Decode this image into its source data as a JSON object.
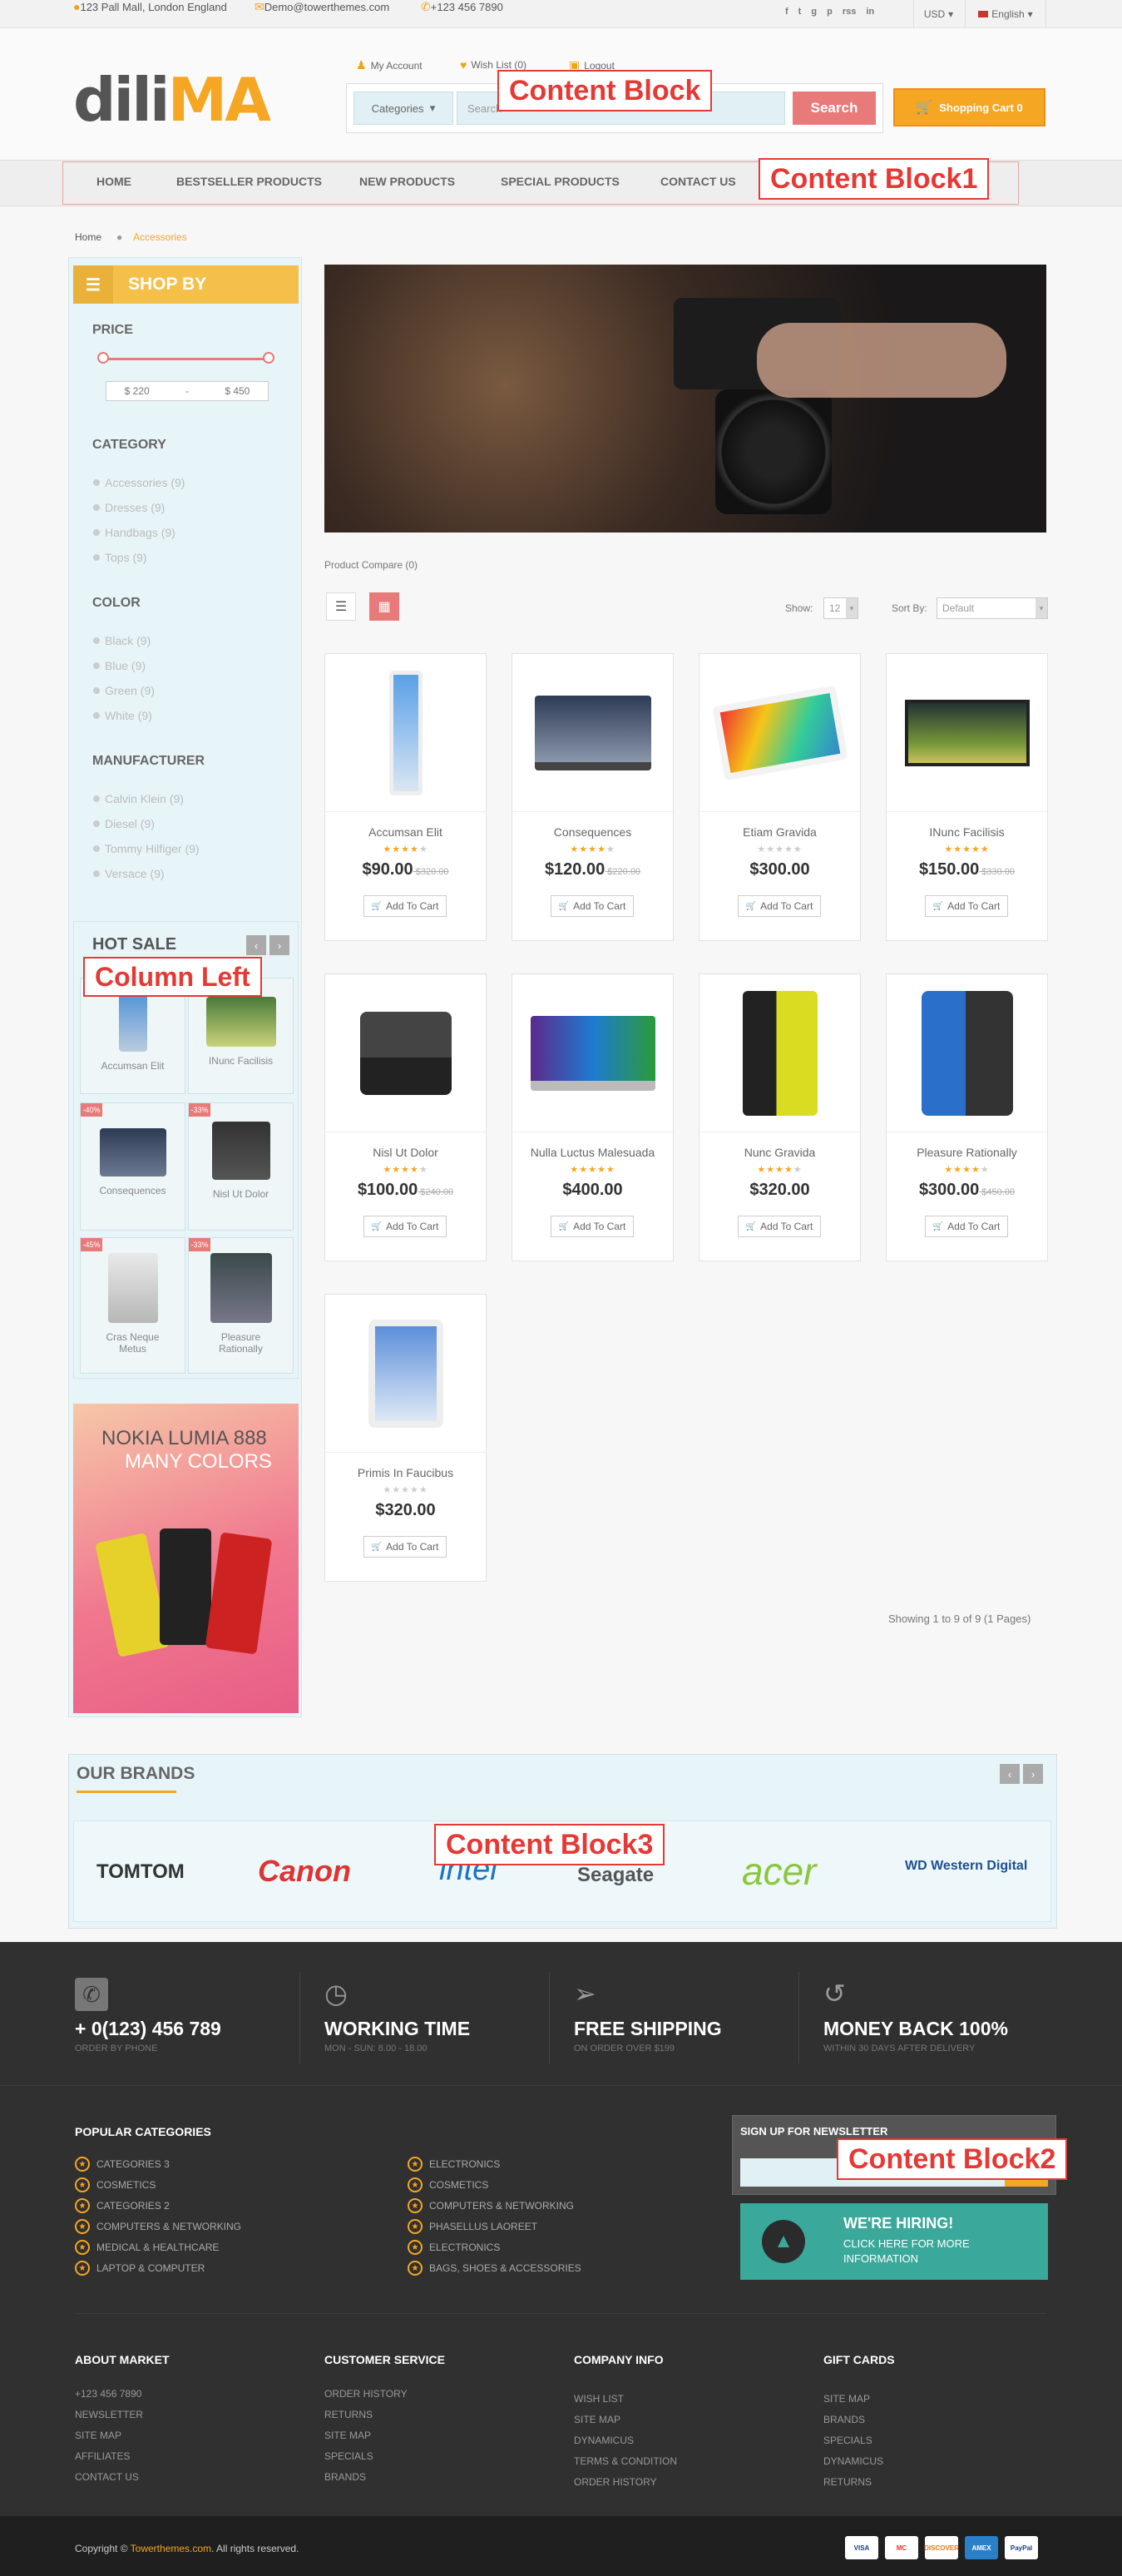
{
  "topbar": {
    "address": "123 Pall Mall, London England",
    "email": "Demo@towerthemes.com",
    "phone": "+123 456 7890",
    "social": [
      "f",
      "t",
      "g",
      "p",
      "rss",
      "in"
    ],
    "currency": "USD",
    "language": "English"
  },
  "header": {
    "logo_a": "dili",
    "logo_b": "MA",
    "my_account": "My Account",
    "wishlist": "Wish List (0)",
    "logout": "Logout",
    "category_select": "Categories",
    "search_placeholder": "Search",
    "search_button": "Search",
    "cart": "Shopping Cart 0"
  },
  "annotations": {
    "content_block": "Content Block",
    "content_block1": "Content Block1",
    "column_left": "Column Left",
    "content_block3": "Content Block3",
    "content_block2": "Content Block2"
  },
  "nav": [
    "HOME",
    "BESTSELLER PRODUCTS",
    "NEW PRODUCTS",
    "SPECIAL PRODUCTS",
    "CONTACT US"
  ],
  "breadcrumb": {
    "home": "Home",
    "current": "Accessories"
  },
  "sidebar": {
    "shop_by": "SHOP BY",
    "price_title": "PRICE",
    "price_min": "$ 220",
    "price_dash": "-",
    "price_max": "$ 450",
    "category_title": "CATEGORY",
    "categories": [
      "Accessories (9)",
      "Dresses (9)",
      "Handbags (9)",
      "Tops (9)"
    ],
    "color_title": "COLOR",
    "colors": [
      "Black (9)",
      "Blue (9)",
      "Green (9)",
      "White (9)"
    ],
    "manufacturer_title": "MANUFACTURER",
    "manufacturers": [
      "Calvin Klein (9)",
      "Diesel (9)",
      "Tommy Hilfiger (9)",
      "Versace (9)"
    ]
  },
  "hot_sale": {
    "title": "HOT SALE",
    "items": [
      {
        "name": "Accumsan Elit",
        "badge": ""
      },
      {
        "name": "INunc Facilisis",
        "badge": ""
      },
      {
        "name": "Consequences",
        "badge": "-40%"
      },
      {
        "name": "Nisl Ut Dolor",
        "badge": "-33%"
      },
      {
        "name": "Cras Neque Metus",
        "badge": "-45%"
      },
      {
        "name": "Pleasure Rationally",
        "badge": "-33%"
      }
    ]
  },
  "nokia_banner": {
    "line1": "NOKIA LUMIA 888",
    "line2": "MANY COLORS"
  },
  "toolbar": {
    "compare": "Product Compare (0)",
    "show_label": "Show:",
    "show_value": "12",
    "sort_label": "Sort By:",
    "sort_value": "Default"
  },
  "products": [
    {
      "name": "Accumsan Elit",
      "price": "$90.00",
      "old": "$320.00",
      "rating": 4,
      "img": "phone-white"
    },
    {
      "name": "Consequences",
      "price": "$120.00",
      "old": "$220.00",
      "rating": 4,
      "img": "laptop"
    },
    {
      "name": "Etiam Gravida",
      "price": "$300.00",
      "old": "",
      "rating": 0,
      "img": "tablet"
    },
    {
      "name": "INunc Facilisis",
      "price": "$150.00",
      "old": "$330.00",
      "rating": 5,
      "img": "monitor"
    },
    {
      "name": "Nisl Ut Dolor",
      "price": "$100.00",
      "old": "$240.00",
      "rating": 4,
      "img": "gamepad"
    },
    {
      "name": "Nulla Luctus Malesuada",
      "price": "$400.00",
      "old": "",
      "rating": 5,
      "img": "laptop-win"
    },
    {
      "name": "Nunc Gravida",
      "price": "$320.00",
      "old": "",
      "rating": 4,
      "img": "phone-yellow"
    },
    {
      "name": "Pleasure Rationally",
      "price": "$300.00",
      "old": "$450.00",
      "rating": 4,
      "img": "phone-black"
    },
    {
      "name": "Primis In Faucibus",
      "price": "$320.00",
      "old": "",
      "rating": 0,
      "img": "ipad"
    }
  ],
  "add_to_cart": "Add To Cart",
  "pagination": "Showing 1 to 9 of 9 (1 Pages)",
  "brands": {
    "title": "OUR BRANDS",
    "items": [
      "TOMTOM",
      "Canon",
      "intel",
      "Seagate",
      "acer",
      "WD Western Digital"
    ]
  },
  "features": [
    {
      "title": "+ 0(123) 456 789",
      "sub": "ORDER BY PHONE",
      "icon": "phone-icon"
    },
    {
      "title": "WORKING TIME",
      "sub": "MON - SUN: 8.00 - 18.00",
      "icon": "clock-icon"
    },
    {
      "title": "FREE SHIPPING",
      "sub": "ON ORDER OVER $199",
      "icon": "plane-icon"
    },
    {
      "title": "MONEY BACK 100%",
      "sub": "WITHIN 30 DAYS AFTER DELIVERY",
      "icon": "refresh-icon"
    }
  ],
  "popular": {
    "title": "POPULAR CATEGORIES",
    "col1": [
      "CATEGORIES 3",
      "COSMETICS",
      "CATEGORIES 2",
      "COMPUTERS & NETWORKING",
      "MEDICAL & HEALTHCARE",
      "LAPTOP & COMPUTER"
    ],
    "col2": [
      "ELECTRONICS",
      "COSMETICS",
      "COMPUTERS & NETWORKING",
      "PHASELLUS LAOREET",
      "ELECTRONICS",
      "BAGS, SHOES & ACCESSORIES"
    ]
  },
  "newsletter": {
    "title": "SIGN UP FOR NEWSLETTER"
  },
  "hiring": {
    "title": "WE'RE HIRING!",
    "sub": "CLICK HERE FOR MORE INFORMATION"
  },
  "footer_cols": [
    {
      "title": "ABOUT MARKET",
      "links": [
        "+123 456 7890",
        "NEWSLETTER",
        "SITE MAP",
        "AFFILIATES",
        "CONTACT US"
      ]
    },
    {
      "title": "CUSTOMER SERVICE",
      "links": [
        "ORDER HISTORY",
        "RETURNS",
        "SITE MAP",
        "SPECIALS",
        "BRANDS"
      ]
    },
    {
      "title": "COMPANY INFO",
      "links": [
        "WISH LIST",
        "SITE MAP",
        "DYNAMICUS",
        "TERMS & CONDITION",
        "ORDER HISTORY"
      ]
    },
    {
      "title": "GIFT CARDS",
      "links": [
        "SITE MAP",
        "BRANDS",
        "SPECIALS",
        "DYNAMICUS",
        "RETURNS"
      ]
    }
  ],
  "copyright": {
    "pre": "Copyright ©",
    "brand": "Towerthemes.com",
    "post": ". All rights reserved."
  },
  "payments": [
    "VISA",
    "MC",
    "DISCOVER",
    "AMEX",
    "PayPal"
  ],
  "colors": {
    "accent": "#f5a623",
    "coral": "#e87a7a",
    "panel": "#e8f5f8",
    "footer": "#303030",
    "teal": "#3aa89a"
  }
}
